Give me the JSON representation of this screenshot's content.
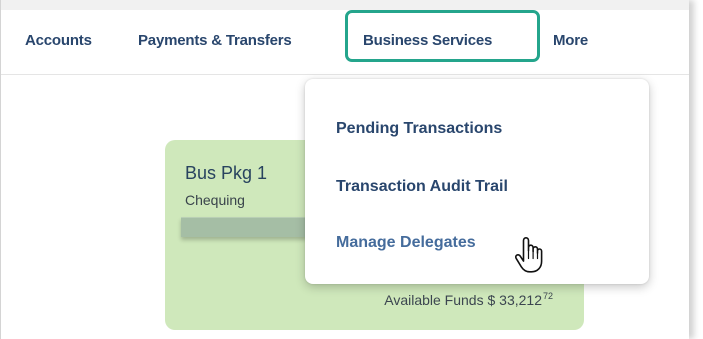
{
  "nav": {
    "items": [
      {
        "label": "Accounts"
      },
      {
        "label": "Payments & Transfers"
      },
      {
        "label": "Business Services",
        "highlighted": true
      },
      {
        "label": "More"
      }
    ]
  },
  "dropdown": {
    "items": [
      {
        "label": "Pending Transactions"
      },
      {
        "label": "Transaction Audit Trail"
      },
      {
        "label": "Manage Delegates",
        "hovered": true
      }
    ]
  },
  "account_card": {
    "name": "Bus Pkg 1",
    "type": "Chequing",
    "funds_label": "Available Funds $ 33,212",
    "funds_cents": "72",
    "background_color": "#cfe8bb"
  },
  "icons": {
    "cursor": "hand-pointer-icon"
  },
  "colors": {
    "nav_text": "#29466d",
    "highlight_border": "#24a58c",
    "hovered_menu_text": "#456c9c"
  }
}
